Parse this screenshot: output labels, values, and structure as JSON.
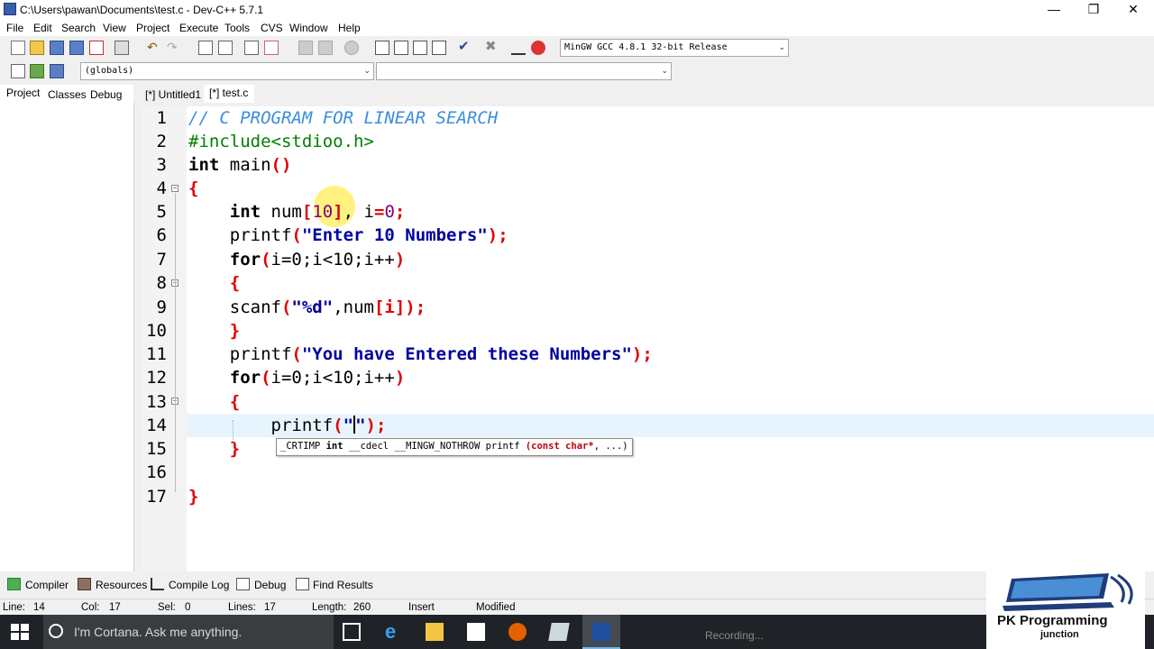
{
  "window": {
    "title": "C:\\Users\\pawan\\Documents\\test.c - Dev-C++ 5.7.1",
    "minimize_glyph": "—",
    "restore_glyph": "❐",
    "close_glyph": "✕"
  },
  "menu": [
    "File",
    "Edit",
    "Search",
    "View",
    "Project",
    "Execute",
    "Tools",
    "CVS",
    "Window",
    "Help"
  ],
  "toolbar": {
    "compiler_select": "MinGW GCC 4.8.1 32-bit Release",
    "scope_select": "(globals)",
    "member_select": ""
  },
  "left_panel_tabs": [
    "Project",
    "Classes",
    "Debug"
  ],
  "editor_tabs": [
    "[*] Untitled1",
    "[*] test.c"
  ],
  "code": {
    "line_numbers": [
      "1",
      "2",
      "3",
      "4",
      "5",
      "6",
      "7",
      "8",
      "9",
      "10",
      "11",
      "12",
      "13",
      "14",
      "15",
      "16",
      "17"
    ],
    "l1": "// C PROGRAM FOR LINEAR SEARCH",
    "l2": "#include<stdioo.h>",
    "l3_kw": "int",
    "l3_rest": " main",
    "l3_paren": "()",
    "brace_open": "{",
    "brace_close": "}",
    "l5_kw": "int",
    "l5_a": " num",
    "l5_lb": "[",
    "l5_n": "10",
    "l5_rb": "]",
    "l5_b": ", i",
    "l5_eq": "=",
    "l5_z": "0",
    "l5_semi": ";",
    "l6_fn": "printf",
    "l6_str": "\"Enter 10 Numbers\"",
    "l7_kw": "for",
    "l7_rest": "i=0;i<10;i++",
    "l9_fn": "scanf",
    "l9_str": "\"%d\"",
    "l9_rest": ",num",
    "l9_idx": "[i]",
    "l11_fn": "printf",
    "l11_str": "\"You have Entered these Numbers\"",
    "l12_kw": "for",
    "l12_rest": "i=0;i<10;i++",
    "l14_fn": "printf",
    "l14_q1": "\"",
    "l14_q2": "\"",
    "tooltip_a": "_CRTIMP ",
    "tooltip_kw": "int",
    "tooltip_b": " __cdecl __MINGW_NOTHROW printf ",
    "tooltip_c": "(const char*",
    "tooltip_d": ", ...)"
  },
  "bottom_tabs": [
    "Compiler",
    "Resources",
    "Compile Log",
    "Debug",
    "Find Results"
  ],
  "status": {
    "line": "Line:",
    "line_val": "14",
    "col": "Col:",
    "col_val": "17",
    "sel": "Sel:",
    "sel_val": "0",
    "lines": "Lines:",
    "lines_val": "17",
    "length": "Length:",
    "length_val": "260",
    "mode": "Insert",
    "state": "Modified"
  },
  "taskbar": {
    "cortana_placeholder": "I'm Cortana. Ask me anything.",
    "recording": "Recording..."
  },
  "watermark": {
    "line1": "PK Programming",
    "line2": "junction"
  },
  "colors": {
    "comment": "#3c8dde",
    "preprocessor": "#008000",
    "brace": "#e00000",
    "string": "#0000a0",
    "number": "#800080",
    "current_line": "#e8f4fd"
  }
}
